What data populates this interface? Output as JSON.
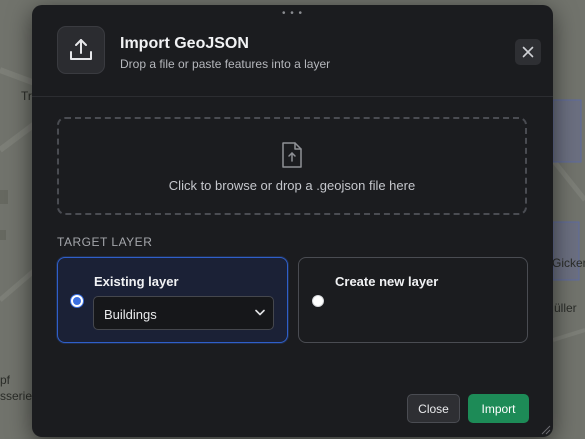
{
  "map": {
    "labels": [
      "Tr",
      "Gicker",
      "üller",
      "pf",
      "sserie"
    ]
  },
  "dialog": {
    "title": "Import GeoJSON",
    "subtitle": "Drop a file or paste features into a layer",
    "header_icon": "upload-icon",
    "close_icon": "close-icon"
  },
  "dropzone": {
    "icon": "file-upload-icon",
    "text": "Click to browse or drop a .geojson file here"
  },
  "target_layer": {
    "label": "TARGET LAYER",
    "options": [
      {
        "title": "Existing layer",
        "selected": true,
        "select_value": "Buildings"
      },
      {
        "title": "Create new layer",
        "selected": false
      }
    ]
  },
  "footer": {
    "close_label": "Close",
    "import_label": "Import"
  },
  "colors": {
    "accent": "#2f5fc9",
    "import_button": "#1d8b57",
    "dialog_bg": "#1b1c1f"
  }
}
